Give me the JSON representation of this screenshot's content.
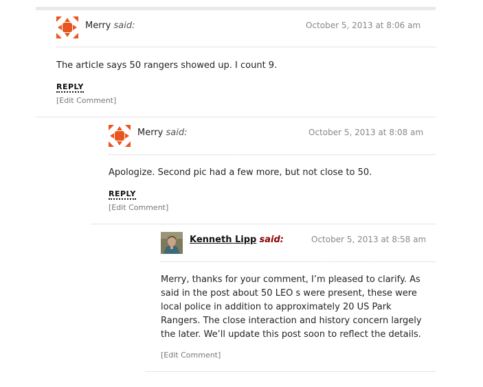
{
  "comments": [
    {
      "author": "Merry",
      "said": "said:",
      "date": "October 5, 2013 at 8:06 am",
      "text": "The article says 50 rangers showed up. I count 9.",
      "reply": "REPLY",
      "edit": "[Edit Comment]",
      "avatar": "geometric-orange-avatar"
    },
    {
      "author": "Merry",
      "said": "said:",
      "date": "October 5, 2013 at 8:08 am",
      "text": "Apologize. Second pic had a few more, but not close to 50.",
      "reply": "REPLY",
      "edit": "[Edit Comment]",
      "avatar": "geometric-orange-avatar"
    },
    {
      "author": "Kenneth Lipp",
      "said": "said:",
      "date": "October 5, 2013 at 8:58 am",
      "text": "Merry, thanks for your comment, I’m pleased to clarify. As said in the post about 50 LEO s were present, these were local police in addition to approximately 20 US Park Rangers. The close interaction and history concern largely the later. We’ll update this post soon to reflect the details.",
      "edit": "[Edit Comment]",
      "avatar": "photo-avatar"
    }
  ],
  "colors": {
    "avatar_orange": "#e8551e",
    "author_link": "#8b0000",
    "meta_gray": "#888888"
  }
}
